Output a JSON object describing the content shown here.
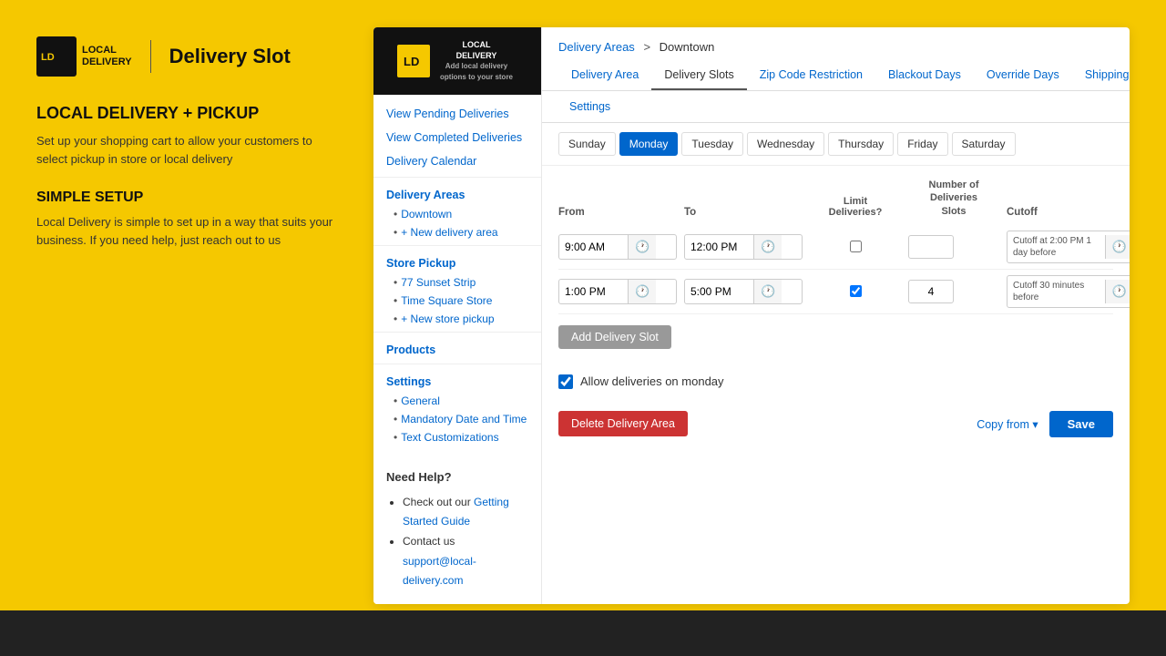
{
  "page": {
    "bg_color": "#F5C800",
    "bottom_bar_color": "#222"
  },
  "logo": {
    "app_name": "LOCAL DELIVERY",
    "page_name": "Delivery Slot",
    "tagline": "Add local delivery options to your store"
  },
  "left_panel": {
    "heading": "LOCAL DELIVERY + PICKUP",
    "description": "Set up your shopping cart to allow your customers to select pickup in store or local delivery",
    "sub_heading": "SIMPLE SETUP",
    "sub_description": "Local Delivery is simple to set up in a way that suits your business. If you need help, just reach out to us"
  },
  "sidebar": {
    "links": [
      {
        "id": "view-pending",
        "label": "View Pending Deliveries"
      },
      {
        "id": "view-completed",
        "label": "View Completed Deliveries"
      },
      {
        "id": "delivery-calendar",
        "label": "Delivery Calendar"
      }
    ],
    "sections": [
      {
        "id": "delivery-areas",
        "title": "Delivery Areas",
        "items": [
          {
            "id": "downtown",
            "label": "Downtown"
          },
          {
            "id": "new-delivery-area",
            "label": "+ New delivery area"
          }
        ]
      },
      {
        "id": "store-pickup",
        "title": "Store Pickup",
        "items": [
          {
            "id": "77-sunset",
            "label": "77 Sunset Strip"
          },
          {
            "id": "time-square",
            "label": "Time Square Store"
          },
          {
            "id": "new-store",
            "label": "+ New store pickup"
          }
        ]
      }
    ],
    "bottom_links": [
      {
        "id": "products",
        "label": "Products"
      },
      {
        "id": "settings",
        "label": "Settings"
      }
    ],
    "settings_items": [
      {
        "id": "general",
        "label": "General"
      },
      {
        "id": "mandatory-date",
        "label": "Mandatory Date and Time"
      },
      {
        "id": "text-customizations",
        "label": "Text Customizations"
      }
    ]
  },
  "need_help": {
    "title": "Need Help?",
    "items": [
      {
        "id": "getting-started",
        "text": "Check out our ",
        "link_text": "Getting Started Guide",
        "link_url": "#"
      },
      {
        "id": "contact",
        "text": "Contact us",
        "link_text": "support@local-delivery.com",
        "link_url": "#"
      }
    ]
  },
  "breadcrumb": {
    "parent": "Delivery Areas",
    "separator": ">",
    "current": "Downtown"
  },
  "tabs": [
    {
      "id": "delivery-area",
      "label": "Delivery Area",
      "active": false
    },
    {
      "id": "delivery-slots",
      "label": "Delivery Slots",
      "active": true
    },
    {
      "id": "zip-code",
      "label": "Zip Code Restriction",
      "active": false
    },
    {
      "id": "blackout-days",
      "label": "Blackout Days",
      "active": false
    },
    {
      "id": "override-days",
      "label": "Override Days",
      "active": false
    },
    {
      "id": "shipping-rates",
      "label": "Shipping Rates",
      "active": false
    }
  ],
  "settings_tab": {
    "label": "Settings"
  },
  "days": [
    {
      "id": "sunday",
      "label": "Sunday",
      "active": false
    },
    {
      "id": "monday",
      "label": "Monday",
      "active": true
    },
    {
      "id": "tuesday",
      "label": "Tuesday",
      "active": false
    },
    {
      "id": "wednesday",
      "label": "Wednesday",
      "active": false
    },
    {
      "id": "thursday",
      "label": "Thursday",
      "active": false
    },
    {
      "id": "friday",
      "label": "Friday",
      "active": false
    },
    {
      "id": "saturday",
      "label": "Saturday",
      "active": false
    }
  ],
  "slots_table": {
    "headers": {
      "from": "From",
      "to": "To",
      "limit_deliveries": "Limit\nDeliveries?",
      "number_slots_line1": "Number of",
      "number_slots_line2": "Deliveries",
      "number_slots_line3": "Slots",
      "cutoff": "Cutoff",
      "action": ""
    },
    "rows": [
      {
        "id": "slot-1",
        "from": "9:00 AM",
        "to": "12:00 PM",
        "limit_checked": false,
        "slots": "",
        "cutoff_text": "Cutoff at 2:00 PM 1 day before",
        "has_cutoff": true
      },
      {
        "id": "slot-2",
        "from": "1:00 PM",
        "to": "5:00 PM",
        "limit_checked": true,
        "slots": "4",
        "cutoff_text": "Cutoff 30 minutes before",
        "has_cutoff": true
      }
    ]
  },
  "buttons": {
    "add_slot": "Add Delivery Slot",
    "delete_area": "Delete Delivery Area",
    "copy_from": "Copy from",
    "save": "Save"
  },
  "allow_deliveries": {
    "checked": true,
    "label": "Allow deliveries on monday"
  }
}
